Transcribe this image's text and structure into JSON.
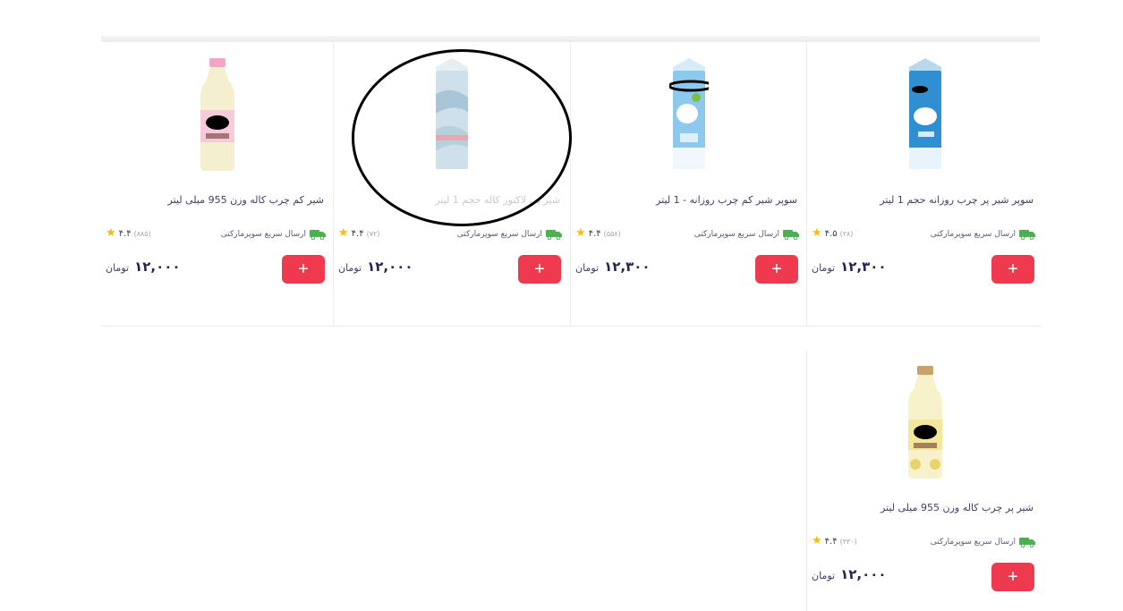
{
  "products": [
    {
      "title": "سوپر شیر پر چرب روزانه حجم 1 لیتر",
      "shipping": "ارسال سریع سوپرمارکتی",
      "rating": "۴.۵",
      "rating_count": "(۲۸)",
      "price": "۱۲,۳۰۰",
      "currency": "تومان",
      "add_label": "+",
      "image": "milk-carton-blue"
    },
    {
      "title": "سوپر شیر کم چرب روزانه - 1 لیتر",
      "shipping": "ارسال سریع سوپرمارکتی",
      "rating": "۴.۴",
      "rating_count": "(۵۵۸)",
      "price": "۱۲,۳۰۰",
      "currency": "تومان",
      "add_label": "+",
      "image": "milk-carton-light-blue"
    },
    {
      "title": "شیر بی لاکتوز کاله حجم 1 لیتر",
      "shipping": "ارسال سریع سوپرمارکتی",
      "rating": "۴.۴",
      "rating_count": "(۷۲)",
      "price": "۱۲,۰۰۰",
      "currency": "تومان",
      "add_label": "+",
      "image": "milk-carton-faded"
    },
    {
      "title": "شیر کم چرب کاله وزن 955 میلی لیتر",
      "shipping": "ارسال سریع سوپرمارکتی",
      "rating": "۴.۴",
      "rating_count": "(۸۸۵)",
      "price": "۱۲,۰۰۰",
      "currency": "تومان",
      "add_label": "+",
      "image": "milk-bottle-pink-cap"
    },
    {
      "title": "شیر پر چرب کاله وزن 955 میلی لیتر",
      "shipping": "ارسال سریع سوپرمارکتی",
      "rating": "۴.۴",
      "rating_count": "(۳۳۰)",
      "price": "۱۲,۰۰۰",
      "currency": "تومان",
      "add_label": "+",
      "image": "milk-bottle-gold-cap"
    }
  ],
  "icons": {
    "shipping": "delivery-truck-icon",
    "rating": "star-icon"
  },
  "colors": {
    "accent": "#ef394e",
    "star": "#f9bc00",
    "shipping_icon": "#4caf50",
    "text": "#3f4064"
  }
}
